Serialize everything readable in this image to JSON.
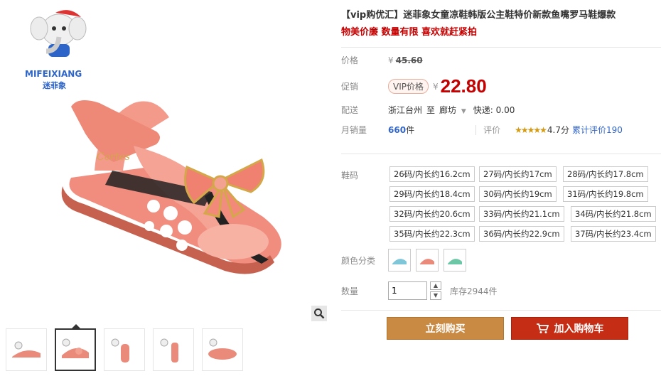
{
  "brand": {
    "name_en": "MIFEIXIANG",
    "name_cn": "迷菲象"
  },
  "product": {
    "title": "【vip购优汇】迷菲象女童凉鞋韩版公主鞋特价新款鱼嘴罗马鞋爆款",
    "subtitle": "物美价廉 数量有限 喜欢就赶紧拍"
  },
  "price": {
    "label": "价格",
    "currency": "¥",
    "original": "45.60"
  },
  "promo": {
    "label": "促销",
    "badge": "VIP价格",
    "currency": "¥",
    "value": "22.80"
  },
  "shipping": {
    "label": "配送",
    "from": "浙江台州",
    "to_word": "至",
    "dest": "廊坊",
    "fee": "快递: 0.00"
  },
  "sales": {
    "label": "月销量",
    "count": "660",
    "unit": "件",
    "rating_label": "评价",
    "stars": "★★★★★",
    "score": "4.7分",
    "reviews": "累计评价190"
  },
  "sizes": {
    "label": "鞋码",
    "options": [
      "26码/内长约16.2cm",
      "27码/内长约17cm",
      "28码/内长约17.8cm",
      "29码/内长约18.4cm",
      "30码/内长约19cm",
      "31码/内长约19.8cm",
      "32码/内长约20.6cm",
      "33码/内长约21.1cm",
      "34码/内长约21.8cm",
      "35码/内长约22.3cm",
      "36码/内长约22.9cm",
      "37码/内长约23.4cm"
    ]
  },
  "colors": {
    "label": "颜色分类"
  },
  "quantity": {
    "label": "数量",
    "value": "1",
    "stock": "库存2944件"
  },
  "buttons": {
    "buy": "立刻购买",
    "cart": "加入购物车"
  },
  "theme": {
    "accent_red": "#c40000",
    "buy_bg": "#c98a43",
    "cart_bg": "#c62d15",
    "link_blue": "#3366cc"
  }
}
